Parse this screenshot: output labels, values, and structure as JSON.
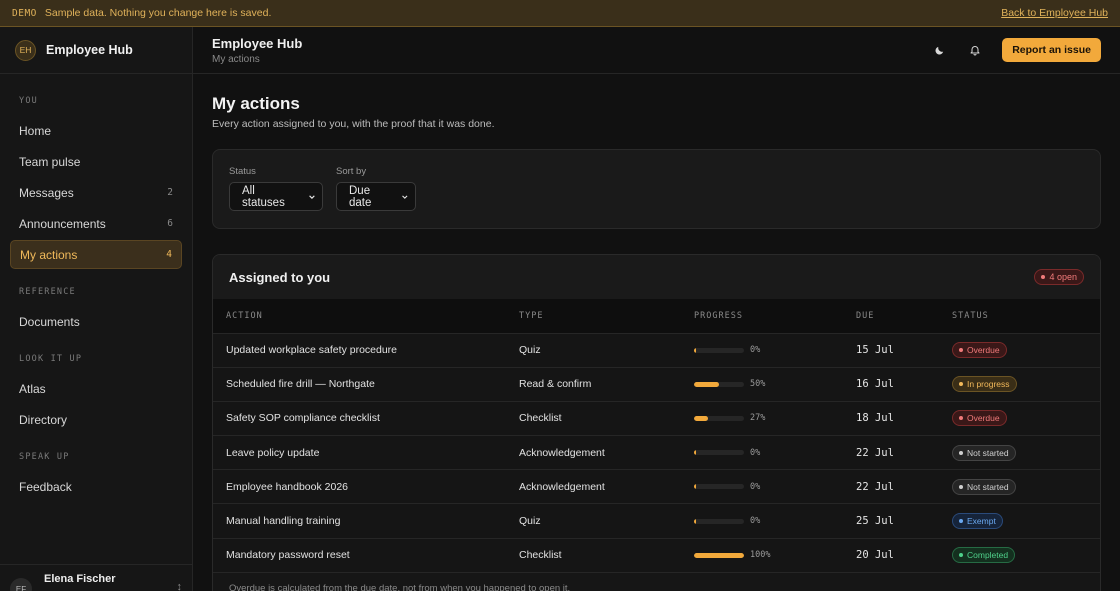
{
  "banner": {
    "tag": "DEMO",
    "text": "Sample data. Nothing you change here is saved.",
    "back_link": "Back to Employee Hub"
  },
  "sidebar": {
    "avatar_initials": "EH",
    "app_name": "Employee Hub",
    "sections": [
      {
        "heading": "YOU",
        "items": [
          {
            "label": "Home",
            "count": ""
          },
          {
            "label": "Team pulse",
            "count": ""
          },
          {
            "label": "Messages",
            "count": "2"
          },
          {
            "label": "Announcements",
            "count": "6"
          },
          {
            "label": "My actions",
            "count": "4",
            "active": true
          }
        ]
      },
      {
        "heading": "REFERENCE",
        "items": [
          {
            "label": "Documents",
            "count": ""
          }
        ]
      },
      {
        "heading": "LOOK IT UP",
        "items": [
          {
            "label": "Atlas",
            "count": ""
          },
          {
            "label": "Directory",
            "count": ""
          }
        ]
      },
      {
        "heading": "SPEAK UP",
        "items": [
          {
            "label": "Feedback",
            "count": ""
          }
        ]
      }
    ],
    "user": {
      "initials": "EF",
      "name": "Elena Fischer"
    }
  },
  "header": {
    "title": "Employee Hub",
    "breadcrumb": "My actions",
    "theme_icon": "moon-icon",
    "notification_icon": "bell-icon",
    "report_button": "Report an issue"
  },
  "main": {
    "title": "My actions",
    "subtitle": "Every action assigned to you, with the proof that it was done.",
    "filters": {
      "status_label": "Status",
      "status_value": "All statuses",
      "sort_label": "Sort by",
      "sort_value": "Due date"
    },
    "panel": {
      "title": "Assigned to you",
      "open_badge": "4 open",
      "columns": [
        "ACTION",
        "TYPE",
        "PROGRESS",
        "DUE",
        "STATUS"
      ],
      "rows": [
        {
          "action": "Updated workplace safety procedure",
          "type": "Quiz",
          "progress": 0,
          "progress_label": "0%",
          "due": "15 Jul",
          "status": "Overdue",
          "status_kind": "overdue"
        },
        {
          "action": "Scheduled fire drill — Northgate",
          "type": "Read & confirm",
          "progress": 50,
          "progress_label": "50%",
          "due": "16 Jul",
          "status": "In progress",
          "status_kind": "progress"
        },
        {
          "action": "Safety SOP compliance checklist",
          "type": "Checklist",
          "progress": 27,
          "progress_label": "27%",
          "due": "18 Jul",
          "status": "Overdue",
          "status_kind": "overdue"
        },
        {
          "action": "Leave policy update",
          "type": "Acknowledgement",
          "progress": 0,
          "progress_label": "0%",
          "due": "22 Jul",
          "status": "Not started",
          "status_kind": "notstarted"
        },
        {
          "action": "Employee handbook 2026",
          "type": "Acknowledgement",
          "progress": 0,
          "progress_label": "0%",
          "due": "22 Jul",
          "status": "Not started",
          "status_kind": "notstarted"
        },
        {
          "action": "Manual handling training",
          "type": "Quiz",
          "progress": 0,
          "progress_label": "0%",
          "due": "25 Jul",
          "status": "Exempt",
          "status_kind": "exempt"
        },
        {
          "action": "Mandatory password reset",
          "type": "Checklist",
          "progress": 100,
          "progress_label": "100%",
          "due": "20 Jul",
          "status": "Completed",
          "status_kind": "completed"
        }
      ],
      "footnote": "Overdue is calculated from the due date, not from when you happened to open it."
    }
  },
  "colors": {
    "accent": "#f2a93b",
    "overdue": "#f07a7a",
    "progress": "#f2b95a",
    "notstarted": "#cfcfcf",
    "exempt": "#6aa8f0",
    "completed": "#4fd08a"
  }
}
